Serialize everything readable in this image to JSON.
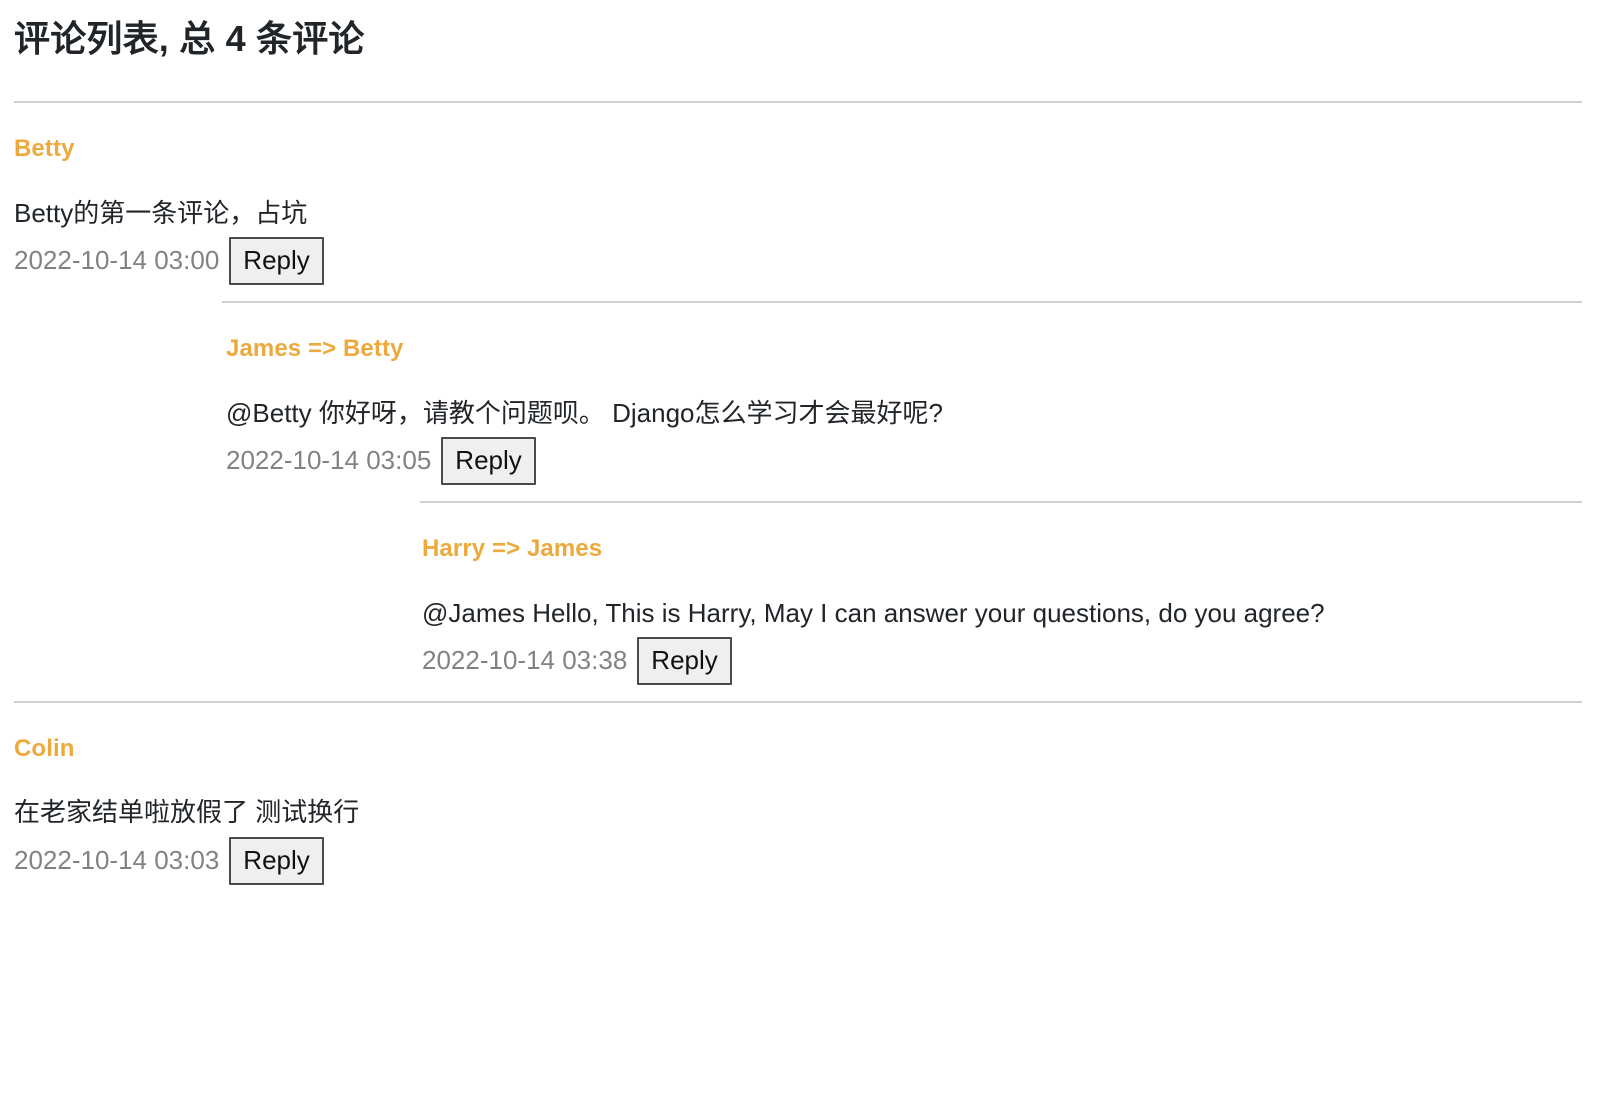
{
  "page": {
    "title": "评论列表, 总 4 条评论",
    "total_comments": 4,
    "accent_color": "#eda93c",
    "text_color": "#212529",
    "meta_color": "#808285",
    "divider_color": "#cfd0d1",
    "button_bg": "#efefef",
    "button_border": "#4a4a4a"
  },
  "labels": {
    "reply": "Reply"
  },
  "comments": [
    {
      "author": "Betty",
      "author_display": "Betty",
      "body": "Betty的第一条评论，占坑",
      "timestamp": "2022-10-14 03:00",
      "reply_label": "Reply",
      "level": 0,
      "replies": [
        {
          "author": "James",
          "parent": "Betty",
          "author_display": "James => Betty",
          "body": "@Betty 你好呀，请教个问题呗。 Django怎么学习才会最好呢?",
          "timestamp": "2022-10-14 03:05",
          "reply_label": "Reply",
          "level": 1,
          "replies": [
            {
              "author": "Harry",
              "parent": "James",
              "author_display": "Harry => James",
              "body": "@James Hello, This is Harry, May I can answer your questions, do you agree?",
              "timestamp": "2022-10-14 03:38",
              "reply_label": "Reply",
              "level": 2,
              "replies": []
            }
          ]
        }
      ]
    },
    {
      "author": "Colin",
      "author_display": "Colin",
      "body": "在老家结单啦放假了 测试换行",
      "timestamp": "2022-10-14 03:03",
      "reply_label": "Reply",
      "level": 0,
      "replies": []
    }
  ]
}
